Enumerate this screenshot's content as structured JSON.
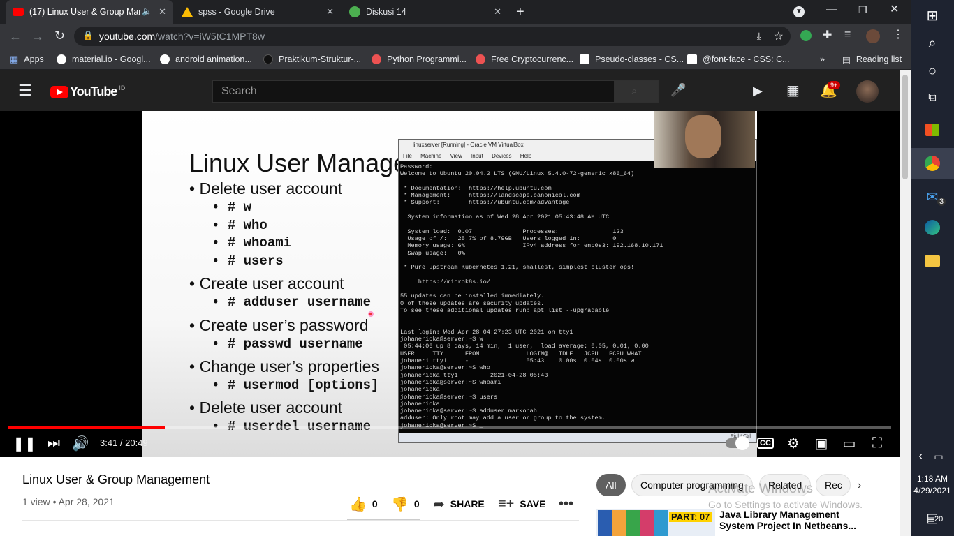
{
  "browser": {
    "tabs": [
      {
        "title": "(17) Linux User & Group Man",
        "active": true
      },
      {
        "title": "spss - Google Drive",
        "active": false
      },
      {
        "title": "Diskusi 14",
        "active": false
      }
    ],
    "url_host": "youtube.com",
    "url_path": "/watch?v=iW5tC1MPT8w",
    "bookmarks": [
      "Apps",
      "material.io - Googl...",
      "android animation...",
      "Praktikum-Struktur-...",
      "Python Programmi...",
      "Free Cryptocurrenc...",
      "Pseudo-classes - CS...",
      "@font-face - CSS: C..."
    ],
    "reading_list": "Reading list",
    "more": "»"
  },
  "youtube": {
    "logo": "YouTube",
    "country": "ID",
    "search_placeholder": "Search",
    "notification_count": "9+"
  },
  "slide": {
    "title": "Linux User Manage",
    "items": [
      {
        "heading": "Delete user account",
        "cmds": [
          "# w",
          "# who",
          "# whoami",
          "# users"
        ]
      },
      {
        "heading": "Create user account",
        "cmds": [
          "# adduser username"
        ]
      },
      {
        "heading": "Create user’s password",
        "cmds": [
          "# passwd username"
        ]
      },
      {
        "heading": "Change user’s properties",
        "cmds": [
          "# usermod [options]"
        ]
      },
      {
        "heading": "Delete user account",
        "cmds": [
          "# userdel username"
        ]
      }
    ]
  },
  "vbox": {
    "title": "linuxserver [Running] - Oracle VM VirtualBox",
    "menu": [
      "File",
      "Machine",
      "View",
      "Input",
      "Devices",
      "Help"
    ],
    "right_ctrl": "Right Ctrl",
    "terminal": [
      "Password:",
      "Welcome to Ubuntu 20.04.2 LTS (GNU/Linux 5.4.0-72-generic x86_64)",
      "",
      " * Documentation:  https://help.ubuntu.com",
      " * Management:     https://landscape.canonical.com",
      " * Support:        https://ubuntu.com/advantage",
      "",
      "  System information as of Wed 28 Apr 2021 05:43:48 AM UTC",
      "",
      "  System load:  0.07              Processes:               123",
      "  Usage of /:   25.7% of 8.79GB   Users logged in:         0",
      "  Memory usage: 6%                IPv4 address for enp0s3: 192.168.10.171",
      "  Swap usage:   0%",
      "",
      " * Pure upstream Kubernetes 1.21, smallest, simplest cluster ops!",
      "",
      "     https://microk8s.io/",
      "",
      "55 updates can be installed immediately.",
      "0 of these updates are security updates.",
      "To see these additional updates run: apt list --upgradable",
      "",
      "",
      "Last login: Wed Apr 28 04:27:23 UTC 2021 on tty1",
      "johanericka@server:~$ w",
      " 05:44:06 up 8 days, 14 min,  1 user,  load average: 0.05, 0.01, 0.00",
      "USER     TTY      FROM             LOGIN@   IDLE   JCPU   PCPU WHAT",
      "johaneri tty1     -                05:43    0.00s  0.04s  0.00s w",
      "johanericka@server:~$ who",
      "johanericka tty1         2021-04-28 05:43",
      "johanericka@server:~$ whoami",
      "johanericka",
      "johanericka@server:~$ users",
      "johanericka",
      "johanericka@server:~$ adduser markonah",
      "adduser: Only root may add a user or group to the system.",
      "johanericka@server:~$ _"
    ]
  },
  "player": {
    "current_time": "3:41",
    "duration": "20:49",
    "time_display": "3:41 / 20:49",
    "progress_fraction": 0.177
  },
  "video": {
    "title": "Linux User & Group Management",
    "meta": "1 view • Apr 28, 2021",
    "likes": "0",
    "dislikes": "0",
    "share": "SHARE",
    "save": "SAVE"
  },
  "chips": [
    "All",
    "Computer programming",
    "Related",
    "Rec"
  ],
  "recommendation": {
    "title": "Java Library Management System Project In Netbeans...",
    "badge": "PART: 07"
  },
  "watermark": {
    "line1": "Activate Windows",
    "line2": "Go to Settings to activate Windows."
  },
  "taskbar": {
    "mail_badge": "3",
    "time": "1:18 AM",
    "date": "4/29/2021",
    "notifications": "20"
  },
  "colors": {
    "youtube_red": "#ff0000",
    "chrome_dark": "#202124",
    "yt_dark": "#212121",
    "taskbar": "#1e2330"
  }
}
